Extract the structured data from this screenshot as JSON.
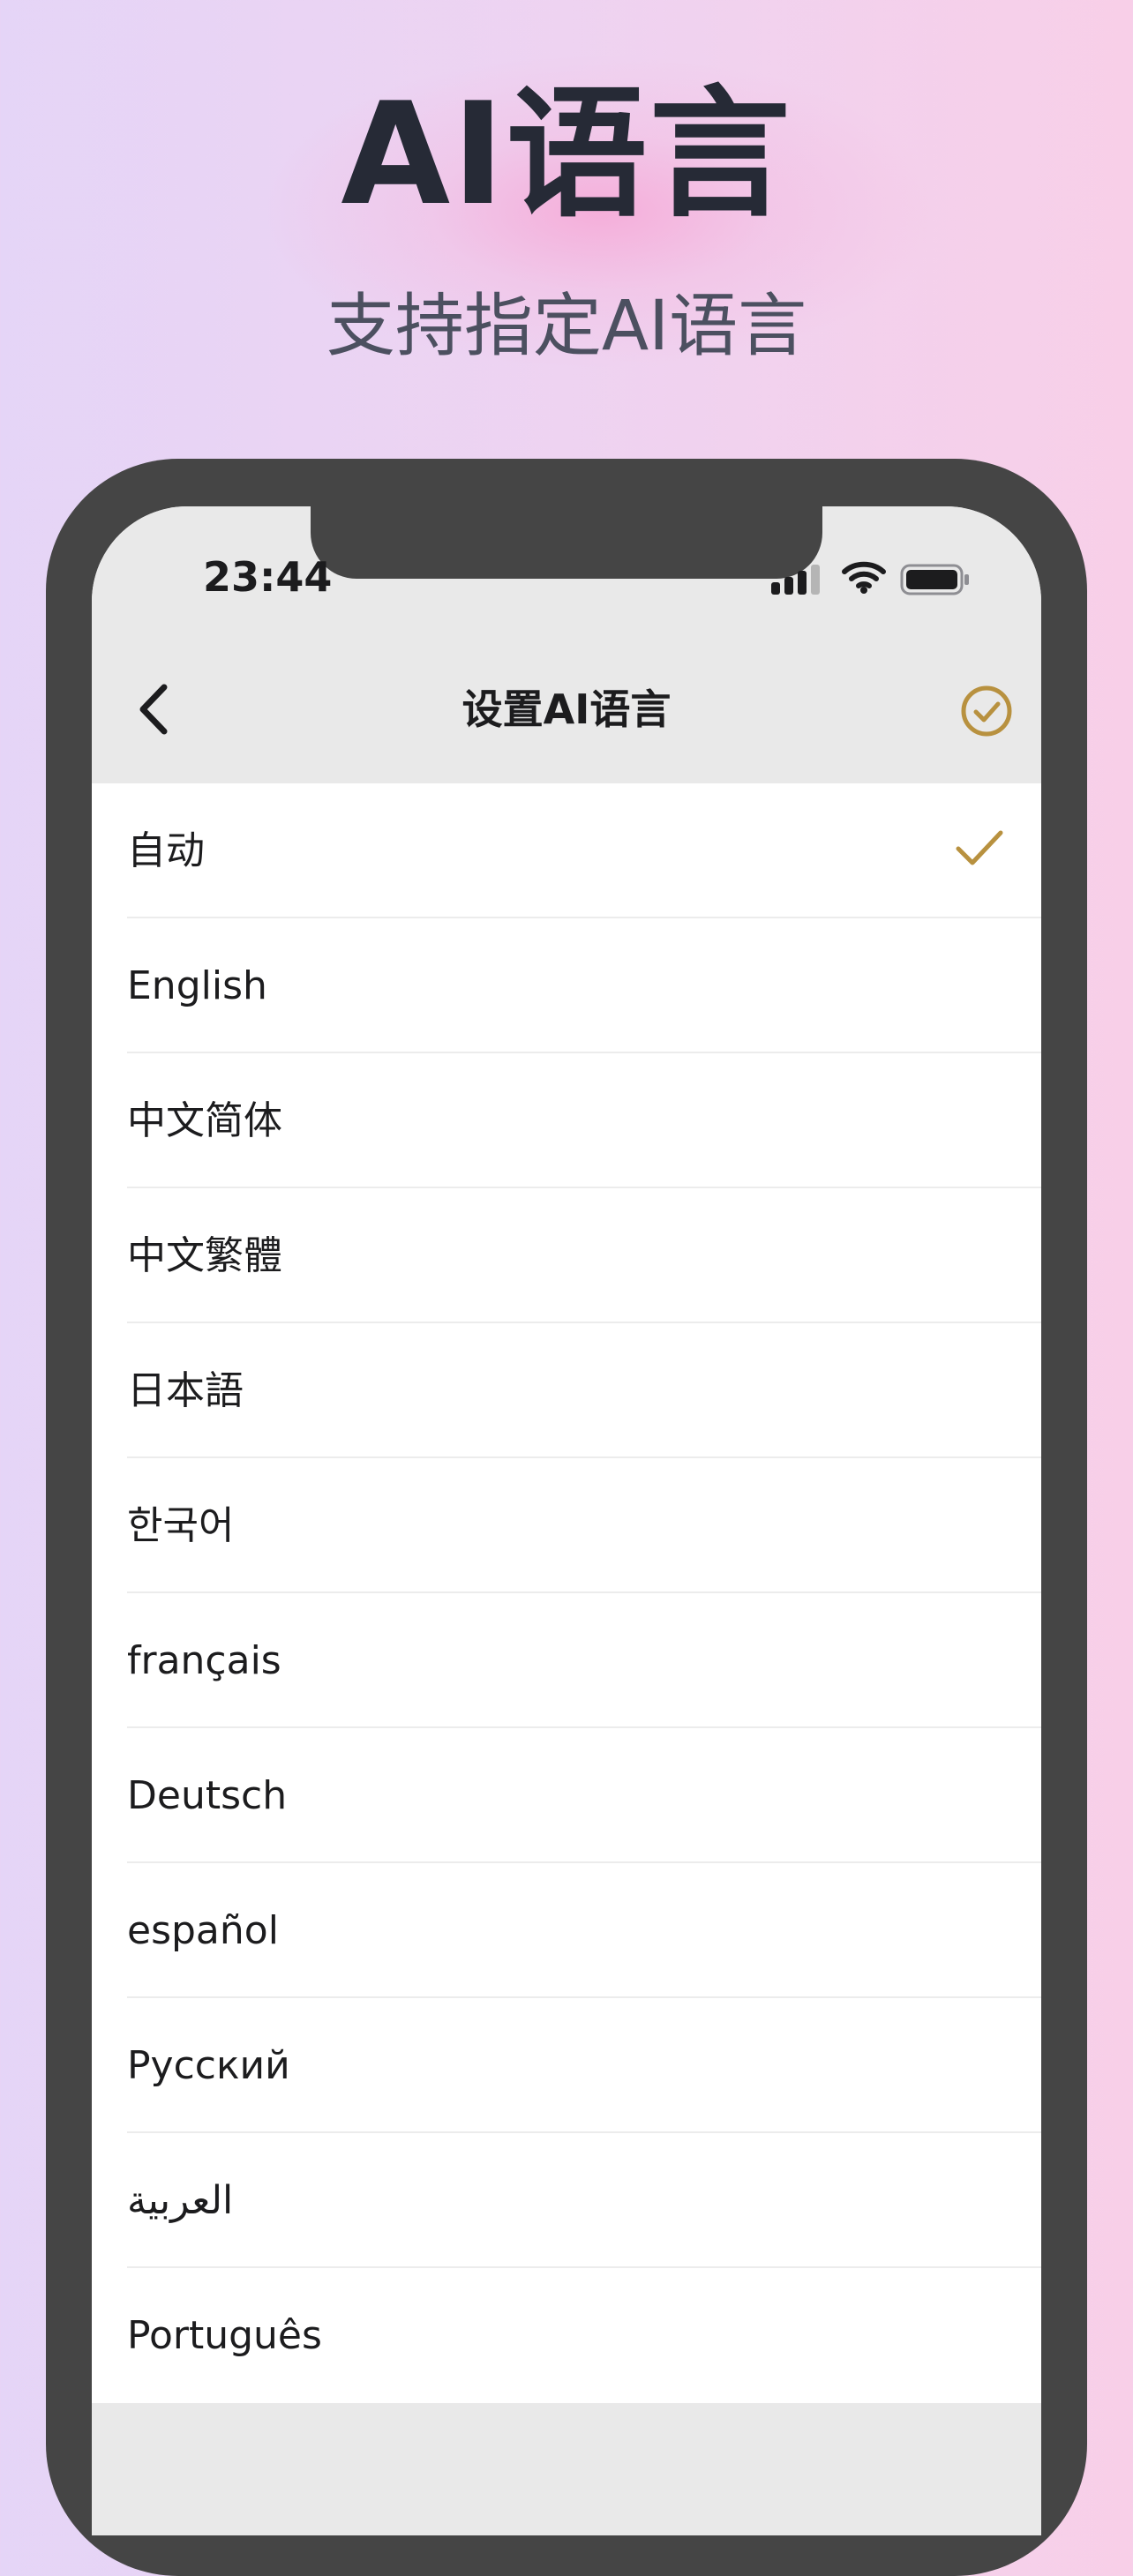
{
  "promo": {
    "title": "AI语言",
    "subtitle": "支持指定AI语言"
  },
  "status_bar": {
    "time": "23:44"
  },
  "nav": {
    "title": "设置AI语言"
  },
  "languages": {
    "selected": "自动",
    "items": [
      "自动",
      "English",
      "中文简体",
      "中文繁體",
      "日本語",
      "한국어",
      "français",
      "Deutsch",
      "español",
      "Русский",
      "العربية",
      "Português"
    ]
  },
  "colors": {
    "accent": "#b8913f",
    "phone_frame": "#454545",
    "header_bg": "#e9e9e9",
    "headline_text": "#262a36",
    "subheadline_text": "#4c5060"
  },
  "icons": {
    "back": "chevron-left-icon",
    "confirm": "check-circle-icon",
    "selected": "checkmark-icon"
  }
}
